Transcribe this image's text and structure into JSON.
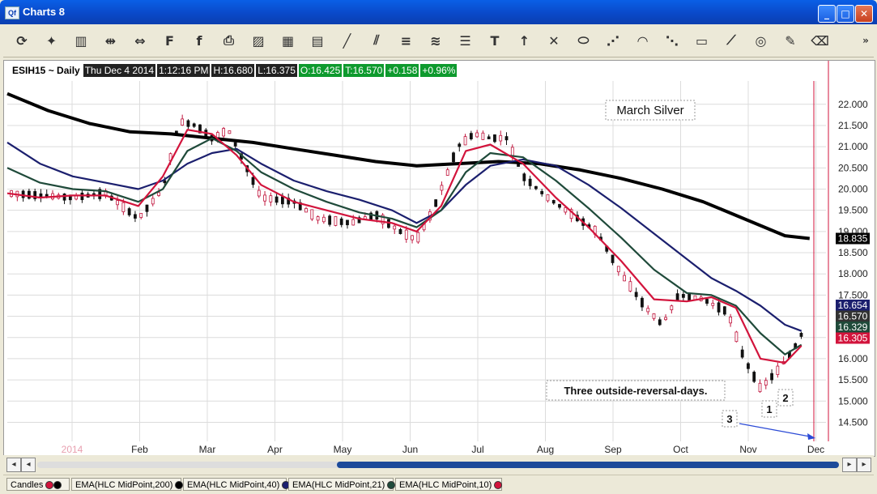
{
  "window": {
    "icon_text": "Qf",
    "title": "Charts 8",
    "minimize": "_",
    "maximize": "□",
    "close": "✕"
  },
  "toolbar": {
    "items": [
      "refresh-icon",
      "magic-icon",
      "chart-type-icon",
      "cursor-arrows-icon",
      "expand-arrows-icon",
      "font-f-icon",
      "font-f-small-icon",
      "print-icon",
      "picture-icon",
      "spreadsheet-icon",
      "report-icon",
      "line-icon",
      "parallel-lines-icon",
      "horizontal-lines-icon",
      "channel-icon",
      "fib-lines-icon",
      "text-tool-icon",
      "arrow-up-icon",
      "crosshair-icon",
      "ellipse-icon",
      "fan-icon",
      "arc-icon",
      "gann-fan-icon",
      "rectangle-icon",
      "speed-lines-icon",
      "circles-icon",
      "highlighter-icon",
      "eraser-icon"
    ],
    "more": "»"
  },
  "header": {
    "symbol": "ESIH15 ~ Daily",
    "date": "Thu Dec 4 2014",
    "time": "1:12:16 PM",
    "high": "H:16.680",
    "low": "L:16.375",
    "open": "O:16.425",
    "trade": "T:16.570",
    "change": "+0.158",
    "pct": "+0.96%"
  },
  "chart_data": {
    "type": "candlestick",
    "title": "March Silver",
    "annotation": "Three outside-reversal-days.",
    "markers": [
      "1",
      "2",
      "3"
    ],
    "x_ticks": [
      "2014",
      "Feb",
      "Mar",
      "Apr",
      "May",
      "Jun",
      "Jul",
      "Aug",
      "Sep",
      "Oct",
      "Nov",
      "Dec"
    ],
    "y_ticks": [
      "22.000",
      "21.500",
      "21.000",
      "20.500",
      "20.000",
      "19.500",
      "19.000",
      "18.500",
      "18.000",
      "17.500",
      "17.000",
      "16.500",
      "16.000",
      "15.500",
      "15.000",
      "14.500"
    ],
    "ylim": [
      14.05,
      22.55
    ],
    "last_labels": [
      {
        "text": "18.835",
        "value": 18.835,
        "bg": "#000000",
        "fg": "#ffffff"
      },
      {
        "text": "16.654",
        "value": 16.654,
        "bg": "#1b1f6e",
        "fg": "#ffffff"
      },
      {
        "text": "16.570",
        "value": 16.57,
        "bg": "#333333",
        "fg": "#ffffff"
      },
      {
        "text": "16.329",
        "value": 16.329,
        "bg": "#1f4a3a",
        "fg": "#ffffff"
      },
      {
        "text": "16.305",
        "value": 16.305,
        "bg": "#d2143c",
        "fg": "#ffffff"
      }
    ],
    "series": [
      {
        "name": "EMA(HLC MidPoint,200)",
        "color": "#000000",
        "points": [
          [
            0,
            22.25
          ],
          [
            5,
            21.85
          ],
          [
            10,
            21.55
          ],
          [
            15,
            21.35
          ],
          [
            20,
            21.3
          ],
          [
            25,
            21.2
          ],
          [
            30,
            21.1
          ],
          [
            35,
            20.95
          ],
          [
            40,
            20.8
          ],
          [
            45,
            20.65
          ],
          [
            50,
            20.55
          ],
          [
            55,
            20.6
          ],
          [
            60,
            20.65
          ],
          [
            65,
            20.6
          ],
          [
            70,
            20.45
          ],
          [
            75,
            20.25
          ],
          [
            80,
            20.0
          ],
          [
            85,
            19.7
          ],
          [
            90,
            19.3
          ],
          [
            95,
            18.9
          ],
          [
            98,
            18.835
          ]
        ]
      },
      {
        "name": "EMA(HLC MidPoint,40)",
        "color": "#1b1f6e",
        "points": [
          [
            0,
            21.1
          ],
          [
            4,
            20.6
          ],
          [
            8,
            20.3
          ],
          [
            12,
            20.15
          ],
          [
            16,
            20.0
          ],
          [
            19,
            20.2
          ],
          [
            22,
            20.6
          ],
          [
            25,
            20.85
          ],
          [
            28,
            20.95
          ],
          [
            31,
            20.6
          ],
          [
            35,
            20.2
          ],
          [
            39,
            19.95
          ],
          [
            43,
            19.75
          ],
          [
            47,
            19.5
          ],
          [
            50,
            19.2
          ],
          [
            53,
            19.5
          ],
          [
            56,
            20.1
          ],
          [
            59,
            20.55
          ],
          [
            63,
            20.7
          ],
          [
            67,
            20.55
          ],
          [
            71,
            20.1
          ],
          [
            75,
            19.55
          ],
          [
            79,
            18.95
          ],
          [
            83,
            18.35
          ],
          [
            86,
            17.9
          ],
          [
            89,
            17.6
          ],
          [
            92,
            17.25
          ],
          [
            95,
            16.8
          ],
          [
            97,
            16.654
          ]
        ]
      },
      {
        "name": "EMA(HLC MidPoint,21)",
        "color": "#1f4a3a",
        "points": [
          [
            0,
            20.5
          ],
          [
            4,
            20.15
          ],
          [
            8,
            20.0
          ],
          [
            12,
            19.95
          ],
          [
            16,
            19.7
          ],
          [
            19,
            20.0
          ],
          [
            22,
            20.9
          ],
          [
            25,
            21.2
          ],
          [
            28,
            20.9
          ],
          [
            31,
            20.4
          ],
          [
            35,
            20.0
          ],
          [
            39,
            19.7
          ],
          [
            43,
            19.45
          ],
          [
            47,
            19.3
          ],
          [
            50,
            19.1
          ],
          [
            53,
            19.5
          ],
          [
            56,
            20.4
          ],
          [
            59,
            20.85
          ],
          [
            63,
            20.75
          ],
          [
            67,
            20.2
          ],
          [
            71,
            19.55
          ],
          [
            75,
            18.85
          ],
          [
            79,
            18.1
          ],
          [
            83,
            17.55
          ],
          [
            86,
            17.5
          ],
          [
            89,
            17.25
          ],
          [
            92,
            16.6
          ],
          [
            95,
            16.1
          ],
          [
            97,
            16.329
          ]
        ]
      },
      {
        "name": "EMA(HLC MidPoint,10)",
        "color": "#d2143c",
        "points": [
          [
            0,
            19.9
          ],
          [
            4,
            19.8
          ],
          [
            8,
            19.85
          ],
          [
            12,
            19.85
          ],
          [
            16,
            19.6
          ],
          [
            19,
            20.3
          ],
          [
            22,
            21.4
          ],
          [
            25,
            21.3
          ],
          [
            28,
            20.8
          ],
          [
            31,
            20.1
          ],
          [
            35,
            19.7
          ],
          [
            39,
            19.5
          ],
          [
            43,
            19.3
          ],
          [
            47,
            19.2
          ],
          [
            50,
            19.0
          ],
          [
            53,
            19.6
          ],
          [
            56,
            20.9
          ],
          [
            59,
            21.05
          ],
          [
            63,
            20.6
          ],
          [
            67,
            19.8
          ],
          [
            71,
            19.1
          ],
          [
            75,
            18.3
          ],
          [
            79,
            17.4
          ],
          [
            83,
            17.35
          ],
          [
            86,
            17.45
          ],
          [
            89,
            17.2
          ],
          [
            92,
            16.0
          ],
          [
            95,
            15.9
          ],
          [
            97,
            16.305
          ]
        ]
      }
    ],
    "candles_path": [
      [
        0,
        19.9
      ],
      [
        4,
        19.85
      ],
      [
        8,
        19.8
      ],
      [
        12,
        19.9
      ],
      [
        16,
        19.3
      ],
      [
        19,
        20.0
      ],
      [
        21,
        21.6
      ],
      [
        23,
        21.5
      ],
      [
        25,
        21.2
      ],
      [
        27,
        21.4
      ],
      [
        29,
        20.6
      ],
      [
        31,
        19.8
      ],
      [
        35,
        19.7
      ],
      [
        38,
        19.3
      ],
      [
        42,
        19.2
      ],
      [
        45,
        19.4
      ],
      [
        48,
        19.0
      ],
      [
        50,
        18.8
      ],
      [
        52,
        19.5
      ],
      [
        55,
        21.0
      ],
      [
        57,
        21.3
      ],
      [
        59,
        21.2
      ],
      [
        61,
        21.2
      ],
      [
        63,
        20.3
      ],
      [
        66,
        19.8
      ],
      [
        69,
        19.4
      ],
      [
        72,
        19.0
      ],
      [
        75,
        18.0
      ],
      [
        78,
        17.2
      ],
      [
        80,
        16.8
      ],
      [
        82,
        17.5
      ],
      [
        85,
        17.4
      ],
      [
        88,
        17.1
      ],
      [
        90,
        16.0
      ],
      [
        92,
        15.3
      ],
      [
        94,
        15.7
      ],
      [
        96,
        16.2
      ],
      [
        97,
        16.57
      ]
    ]
  },
  "legend": {
    "candles": "Candles",
    "ema200": "EMA(HLC MidPoint,200)",
    "ema40": "EMA(HLC MidPoint,40)",
    "ema21": "EMA(HLC MidPoint,21)",
    "ema10": "EMA(HLC MidPoint,10)"
  },
  "colors": {
    "accent": "#0a49c9",
    "ema10": "#d2143c",
    "ema21": "#1f4a3a",
    "ema40": "#1b1f6e",
    "ema200": "#000000",
    "trade_bg": "#0e9a2e"
  },
  "scroll": {
    "left": "◂",
    "right": "▸",
    "far_left": "◂",
    "far_right": "▸"
  }
}
